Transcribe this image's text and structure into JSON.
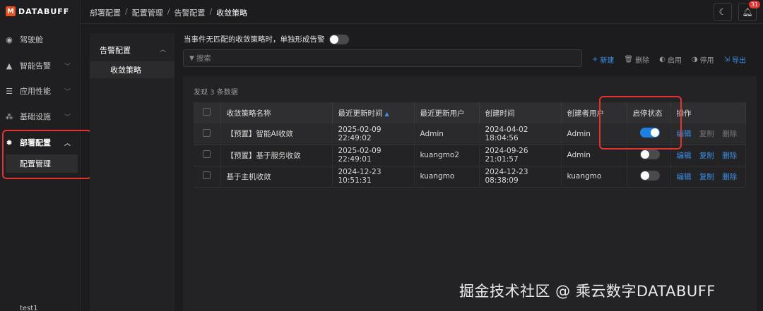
{
  "brand": {
    "logo_text": "DATABUFF"
  },
  "nav": {
    "items": [
      {
        "label": "驾驶舱",
        "icon": "dashboard-icon"
      },
      {
        "label": "智能告警",
        "icon": "bell-icon"
      },
      {
        "label": "应用性能",
        "icon": "filter-icon"
      },
      {
        "label": "基础设施",
        "icon": "cluster-icon"
      },
      {
        "label": "部署配置",
        "icon": "gear-icon"
      }
    ],
    "sub_item": "配置管理",
    "user": "test1"
  },
  "breadcrumb": [
    "部署配置",
    "配置管理",
    "告警配置",
    "收敛策略"
  ],
  "header": {
    "notification_count": "31"
  },
  "subpanel": {
    "group": "告警配置",
    "item": "收敛策略"
  },
  "content": {
    "toggle_label": "当事件无匹配的收敛策略时，单独形成告警",
    "search_placeholder": "搜索",
    "actions": {
      "new": "新建",
      "delete": "删除",
      "enable": "启用",
      "disable": "停用",
      "export": "导出"
    },
    "found_text": "发现 3 条数据",
    "columns": [
      "收敛策略名称",
      "最近更新时间",
      "最近更新用户",
      "创建时间",
      "创建者用户",
      "启停状态",
      "操作"
    ],
    "rows": [
      {
        "name": "【预置】智能AI收敛",
        "updated": "2025-02-09 22:49:02",
        "updater": "Admin",
        "created": "2024-04-02 18:04:56",
        "creator": "Admin",
        "enabled": true,
        "ops": [
          "编辑",
          "复制",
          "删除"
        ]
      },
      {
        "name": "【预置】基于服务收敛",
        "updated": "2025-02-09 22:49:01",
        "updater": "kuangmo2",
        "created": "2024-09-26 21:01:57",
        "creator": "Admin",
        "enabled": false,
        "ops": [
          "编辑",
          "复制",
          "删除"
        ]
      },
      {
        "name": "基于主机收敛",
        "updated": "2024-12-23 10:51:31",
        "updater": "kuangmo",
        "created": "2024-12-23 08:38:09",
        "creator": "kuangmo",
        "enabled": false,
        "ops": [
          "编辑",
          "复制",
          "删除"
        ]
      }
    ]
  },
  "watermark": "掘金技术社区 @ 乘云数字DATABUFF",
  "colors": {
    "accent": "#1f7fe0",
    "highlight": "#e2332f",
    "brand": "#e8501e"
  }
}
